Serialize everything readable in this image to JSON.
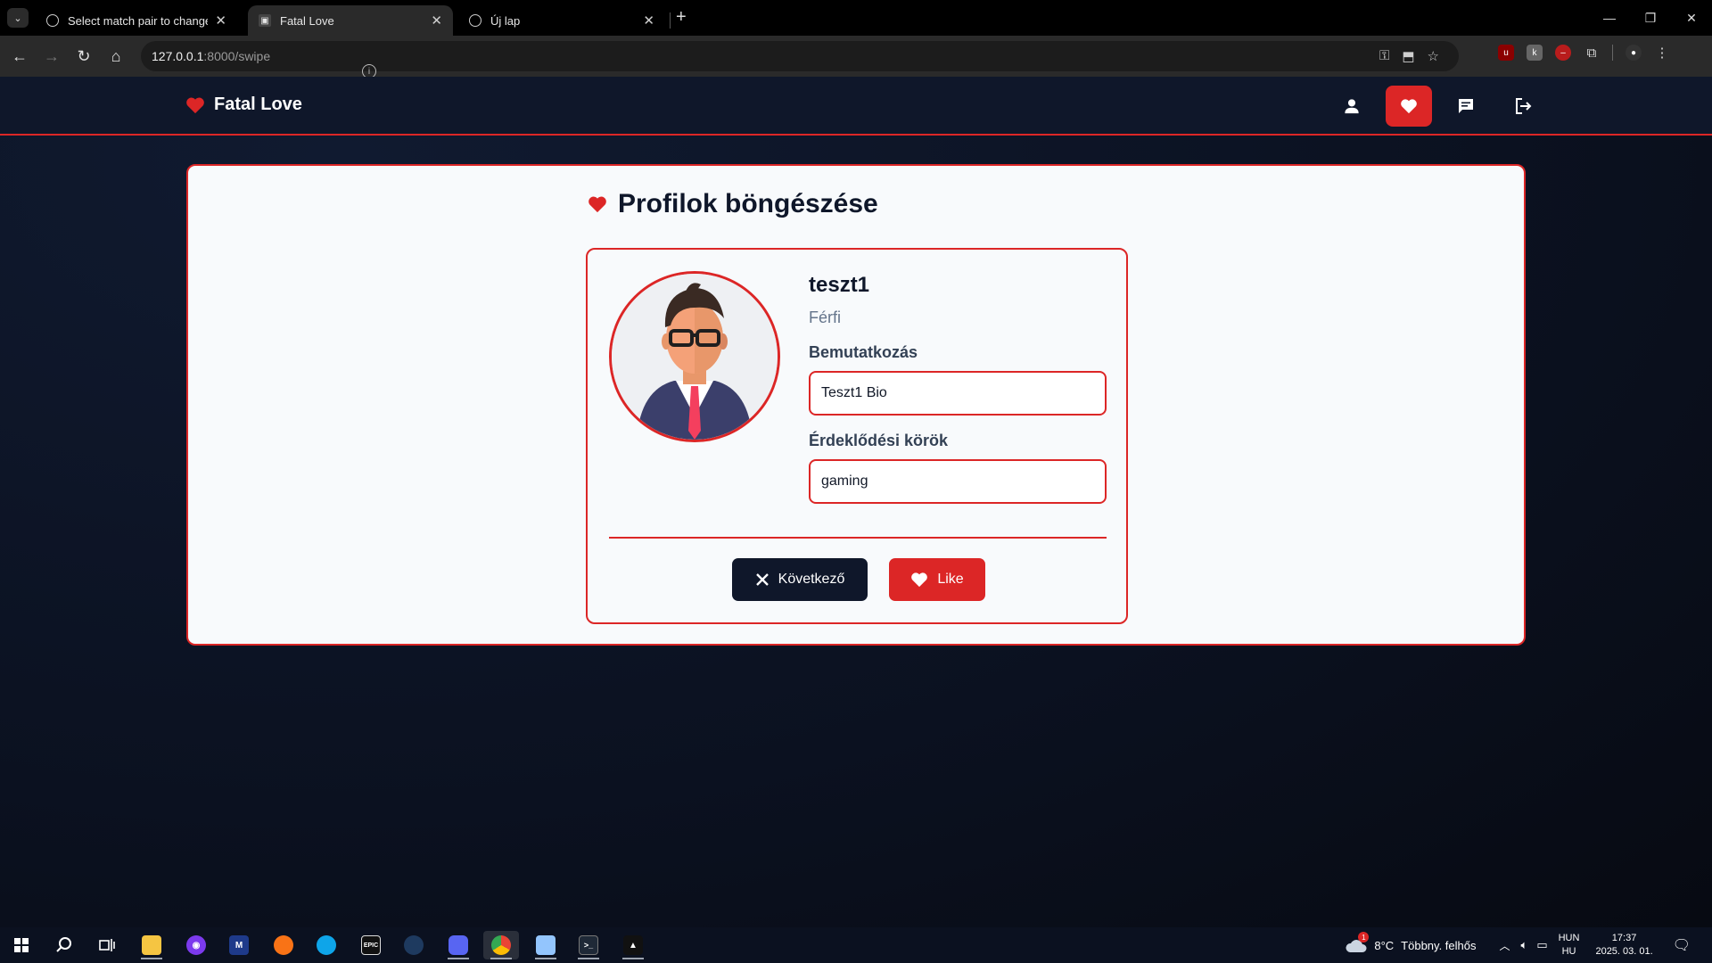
{
  "browser": {
    "tabs": [
      {
        "title": "Select match pair to change | D",
        "active": false
      },
      {
        "title": "Fatal Love",
        "active": true
      },
      {
        "title": "Új lap",
        "active": false
      }
    ],
    "url_host": "127.0.0.1",
    "url_path": ":8000/swipe"
  },
  "app": {
    "brand": "Fatal Love",
    "nav_icons": [
      "user-icon",
      "heart-icon",
      "chat-icon",
      "logout-icon"
    ],
    "active_nav": "heart-icon",
    "accent_color": "#dc2626",
    "dark_color": "#0f172a"
  },
  "page": {
    "title": "Profilok böngészése"
  },
  "profile": {
    "username": "teszt1",
    "gender": "Férfi",
    "bio_label": "Bemutatkozás",
    "bio_value": "Teszt1 Bio",
    "interests_label": "Érdeklődési körök",
    "interests_value": "gaming"
  },
  "actions": {
    "next_label": "Következő",
    "like_label": "Like"
  },
  "taskbar": {
    "weather_temp": "8°C",
    "weather_desc": "Többny. felhős",
    "weather_badge": "1",
    "lang_top": "HUN",
    "lang_bottom": "HU",
    "time": "17:37",
    "date": "2025. 03. 01."
  }
}
